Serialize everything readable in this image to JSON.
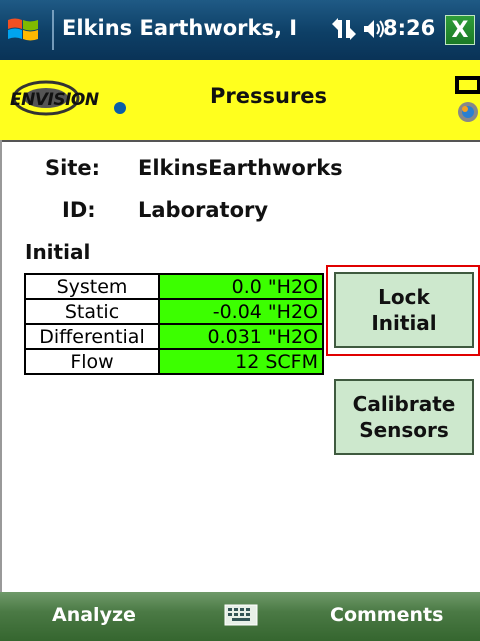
{
  "titlebar": {
    "title": "Elkins Earthworks, I",
    "time": "8:26",
    "close_label": "X",
    "icons": [
      "windows-start-icon",
      "connectivity-icon",
      "volume-icon"
    ]
  },
  "header": {
    "logo_text": "ENVISION",
    "title": "Pressures",
    "icons": [
      "battery-icon",
      "pressure-gauge-icon"
    ]
  },
  "info": {
    "site_label": "Site:",
    "site_value": "ElkinsEarthworks",
    "id_label": "ID:",
    "id_value": "Laboratory",
    "section_label": "Initial"
  },
  "readings": [
    {
      "name": "System",
      "value": "0.0  \"H2O"
    },
    {
      "name": "Static",
      "value": "-0.04 \"H2O"
    },
    {
      "name": "Differential",
      "value": "0.031 \"H2O"
    },
    {
      "name": "Flow",
      "value": "12 SCFM"
    }
  ],
  "buttons": {
    "lock_initial": "Lock\nInitial",
    "lock_line1": "Lock",
    "lock_line2": "Initial",
    "calibrate_line1": "Calibrate",
    "calibrate_line2": "Sensors"
  },
  "bottombar": {
    "left": "Analyze",
    "right": "Comments",
    "center_icon": "keyboard-icon"
  },
  "colors": {
    "titlebar": "#0d3f66",
    "header": "#ffff1e",
    "value_cell": "#3cff00",
    "button": "#cde8cd",
    "focus_border": "#e00000",
    "bottombar": "#4b7a45"
  }
}
